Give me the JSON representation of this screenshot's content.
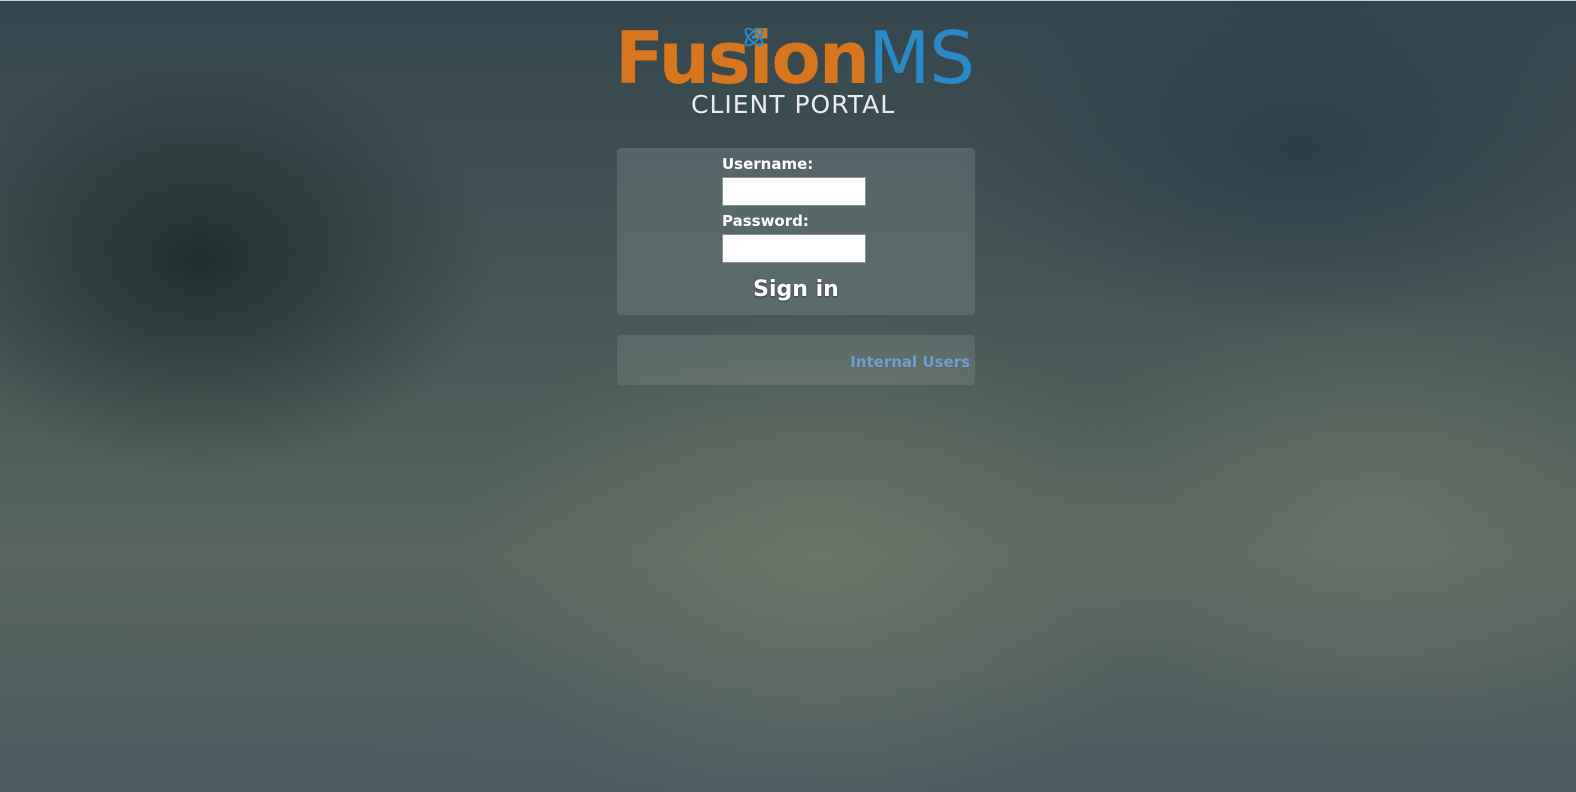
{
  "logo": {
    "word_primary": "Fusion",
    "word_secondary": "MS",
    "subtitle": "CLIENT PORTAL",
    "primary_color": "#d8761d",
    "secondary_color": "#2a8ac8",
    "icon": "atom-icon"
  },
  "login_form": {
    "username_label": "Username:",
    "username_value": "",
    "password_label": "Password:",
    "password_value": "",
    "submit_label": "Sign in"
  },
  "footer_links": {
    "internal_users_label": "Internal Users",
    "link_color": "#6f9ed4"
  }
}
